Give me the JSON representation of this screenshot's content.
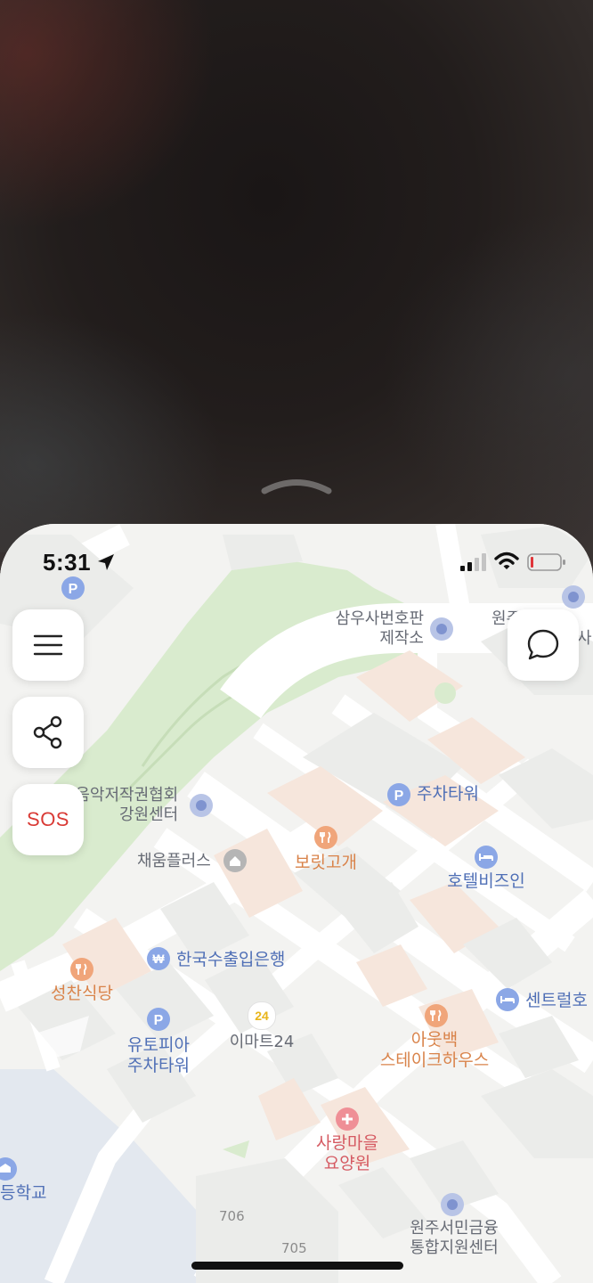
{
  "status": {
    "time": "5:31",
    "signal_bars_active": 2,
    "battery_level": 0.1
  },
  "colors": {
    "map_bg": "#f3f3f1",
    "park": "#d9ebce",
    "sos_red": "#d93a35",
    "road": "#ffffff"
  },
  "buttons": {
    "menu": {
      "icon": "hamburger-icon"
    },
    "share": {
      "icon": "share-icon"
    },
    "sos": {
      "label": "SOS"
    },
    "chat": {
      "icon": "chat-bubble-icon"
    }
  },
  "map": {
    "labels": {
      "samusa_1": "삼우사번호판",
      "samusa_2": "제작소",
      "wonju_cut_1": "원주",
      "wonju_cut_2": "사",
      "music_1": "음악저작권협회",
      "music_2": "강원센터",
      "parking_tower": "주차타워",
      "chaeum": "채움플러스",
      "borit": "보릿고개",
      "hotel_biz": "호텔비즈인",
      "exim_bank": "한국수출입은행",
      "seongchan": "성찬식당",
      "central": "센트럴호",
      "utopia_1": "유토피아",
      "utopia_2": "주차타워",
      "emart24_logo": "24",
      "emart24": "이마트24",
      "outback_1": "아웃백",
      "outback_2": "스테이크하우스",
      "saranmaeul_1": "사랑마을",
      "saranmaeul_2": "요양원",
      "school": "등학교",
      "finance_1": "원주서민금융",
      "finance_2": "통합지원센터",
      "bldg_706": "706",
      "bldg_705": "705"
    }
  }
}
